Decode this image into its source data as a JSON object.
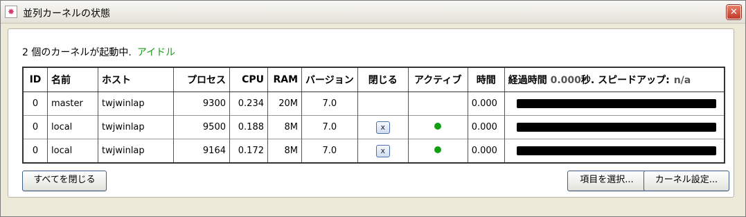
{
  "window": {
    "title": "並列カーネルの状態",
    "close_label": "✕"
  },
  "status": {
    "text": "2 個のカーネルが起動中.",
    "state": "アイドル"
  },
  "table": {
    "headers": {
      "id": "ID",
      "name": "名前",
      "host": "ホスト",
      "process": "プロセス",
      "cpu": "CPU",
      "ram": "RAM",
      "version": "バージョン",
      "close": "閉じる",
      "active": "アクティブ",
      "time": "時間",
      "elapsed_label": "経過時間",
      "elapsed_value": "0.000",
      "elapsed_unit": "秒.",
      "speedup_label": "スピードアップ:",
      "speedup_value": "n/a"
    },
    "rows": [
      {
        "id": "0",
        "name": "master",
        "host": "twjwinlap",
        "process": "9300",
        "cpu": "0.234",
        "ram": "20M",
        "version": "7.0",
        "close": "",
        "active": false,
        "time": "0.000",
        "progress": 1.0
      },
      {
        "id": "0",
        "name": "local",
        "host": "twjwinlap",
        "process": "9500",
        "cpu": "0.188",
        "ram": "8M",
        "version": "7.0",
        "close": "x",
        "active": true,
        "time": "0.000",
        "progress": 1.0
      },
      {
        "id": "0",
        "name": "local",
        "host": "twjwinlap",
        "process": "9164",
        "cpu": "0.172",
        "ram": "8M",
        "version": "7.0",
        "close": "x",
        "active": true,
        "time": "0.000",
        "progress": 1.0
      }
    ]
  },
  "buttons": {
    "close_all": "すべてを閉じる",
    "select_items": "項目を選択...",
    "kernel_settings": "カーネル設定..."
  },
  "colors": {
    "idle": "#1a9a1a",
    "active_dot": "#12a012",
    "bar": "#000000"
  },
  "icons": {
    "app": "kernel-status-icon",
    "close": "close-icon",
    "row_close": "close-kernel-icon",
    "active": "active-dot-icon"
  }
}
